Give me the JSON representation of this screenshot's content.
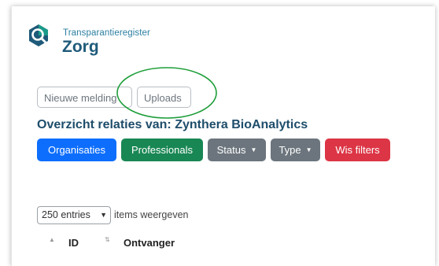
{
  "brand": {
    "name_top": "Transparantieregister",
    "name_main": "Zorg",
    "logo_icon": "magnifier-logo-icon",
    "colors": {
      "teal": "#1b9a8a",
      "navy": "#1e5a7a"
    }
  },
  "top_buttons": {
    "new_report": "Nieuwe melding",
    "uploads": "Uploads"
  },
  "page_title": "Overzicht relaties van: Zynthera BioAnalytics",
  "filters": {
    "organisations": "Organisaties",
    "professionals": "Professionals",
    "status": "Status",
    "type": "Type",
    "clear": "Wis filters",
    "colors": {
      "blue": "#0d6efd",
      "green": "#198754",
      "gray": "#6c757d",
      "red": "#dc3545"
    }
  },
  "table_controls": {
    "entries_select": "250 entries",
    "entries_suffix": "items weergeven"
  },
  "table": {
    "columns": [
      "ID",
      "Ontvanger"
    ]
  },
  "annotation": {
    "color": "#1e9e3a",
    "icon": "highlight-ellipse"
  }
}
